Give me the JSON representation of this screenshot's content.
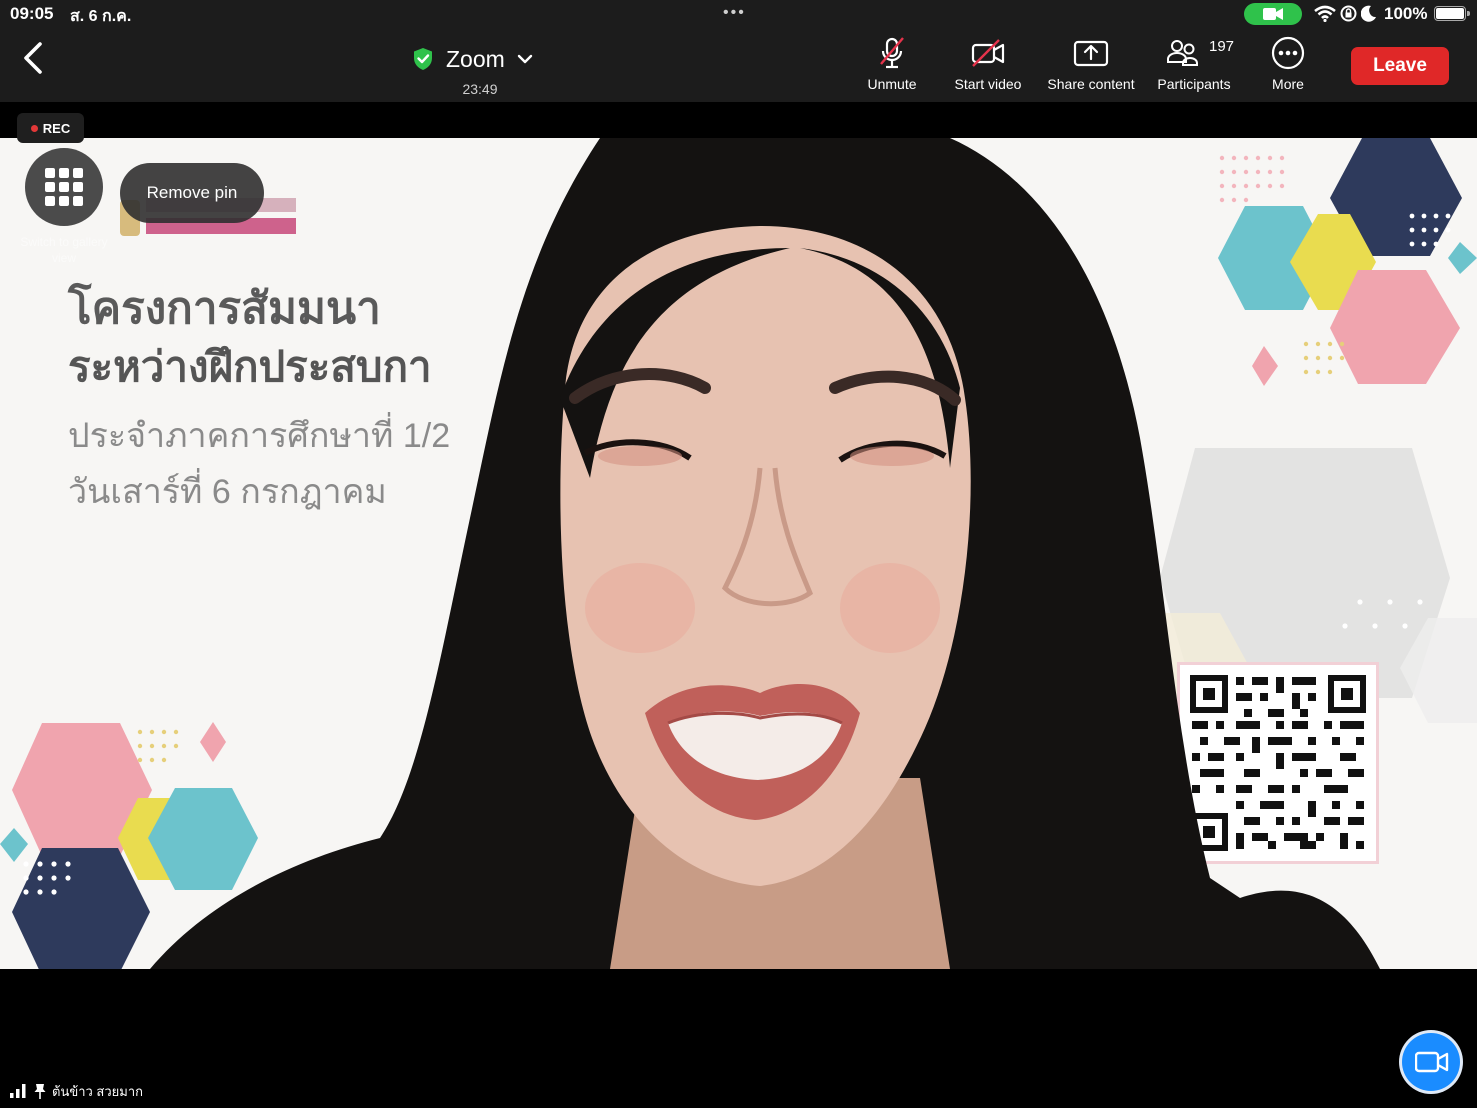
{
  "status_bar": {
    "time": "09:05",
    "date": "ส. 6 ก.ค.",
    "dots": "•••",
    "battery": "100%"
  },
  "toolbar": {
    "title": "Zoom",
    "timer": "23:49",
    "unmute_label": "Unmute",
    "start_video_label": "Start video",
    "share_label": "Share content",
    "participants_label": "Participants",
    "participants_count": "197",
    "more_label": "More",
    "leave_label": "Leave"
  },
  "video": {
    "rec_label": "REC",
    "remove_pin_label": "Remove pin",
    "gallery_caption": "Switch to gallery view",
    "slide_line1": "โครงการสัมมนา",
    "slide_line2": "ระหว่างฝึกประสบกา",
    "slide_line3": "ประจำภาคการศึกษาที่ 1/2",
    "slide_line4": "วันเสาร์ที่ 6 กรกฎาคม"
  },
  "name_tag": {
    "name": "ต้นข้าว สวยมาก"
  },
  "colors": {
    "leave": "#e02828",
    "shield": "#2fc24b",
    "fab": "#1a8cff",
    "hex_pink": "#f0a4ae",
    "hex_yellow": "#e9dc4f",
    "hex_teal": "#6cc3cc",
    "hex_navy": "#2e3a5c"
  },
  "icons": [
    "back-chevron-icon",
    "shield-check-icon",
    "chevron-down-icon",
    "mic-off-icon",
    "video-off-icon",
    "share-icon",
    "participants-icon",
    "more-icon",
    "grid-icon",
    "video-camera-icon",
    "signal-icon",
    "pin-icon"
  ]
}
